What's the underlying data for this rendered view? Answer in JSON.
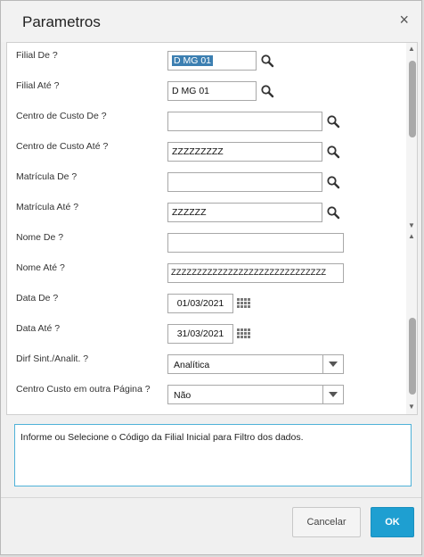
{
  "window": {
    "title": "Parametros",
    "close_glyph": "×"
  },
  "fields": [
    {
      "label": "Filial De ?",
      "value": "D MG 01",
      "kind": "search",
      "selected": true
    },
    {
      "label": "Filial Até ?",
      "value": "D MG 01",
      "kind": "search"
    },
    {
      "label": "Centro de Custo De ?",
      "value": "",
      "kind": "search"
    },
    {
      "label": "Centro de Custo Até ?",
      "value": "ZZZZZZZZZ",
      "kind": "search"
    },
    {
      "label": "Matrícula De ?",
      "value": "",
      "kind": "search"
    },
    {
      "label": "Matrícula Até ?",
      "value": "ZZZZZZ",
      "kind": "search"
    },
    {
      "label": "Nome De ?",
      "value": "",
      "kind": "text"
    },
    {
      "label": "Nome Até ?",
      "value": "ZZZZZZZZZZZZZZZZZZZZZZZZZZZZZZ",
      "kind": "text"
    },
    {
      "label": "Data De ?",
      "value": "01/03/2021",
      "kind": "date"
    },
    {
      "label": "Data Até ?",
      "value": "31/03/2021",
      "kind": "date"
    },
    {
      "label": "Dirf Sint./Analit. ?",
      "value": "Analítica",
      "kind": "combo"
    },
    {
      "label": "Centro Custo em outra Página ?",
      "value": "Não",
      "kind": "combo"
    }
  ],
  "help_text": "Informe ou Selecione o Código da Filial Inicial para Filtro dos dados.",
  "buttons": {
    "cancel": "Cancelar",
    "ok": "OK"
  },
  "icons": {
    "search": "search-icon",
    "calendar": "calendar-icon",
    "dropdown": "chevron-down-icon",
    "close": "close-icon"
  },
  "colors": {
    "accent": "#1e9fd1",
    "selection": "#3c7fb1",
    "help_border": "#4fb2d8"
  }
}
